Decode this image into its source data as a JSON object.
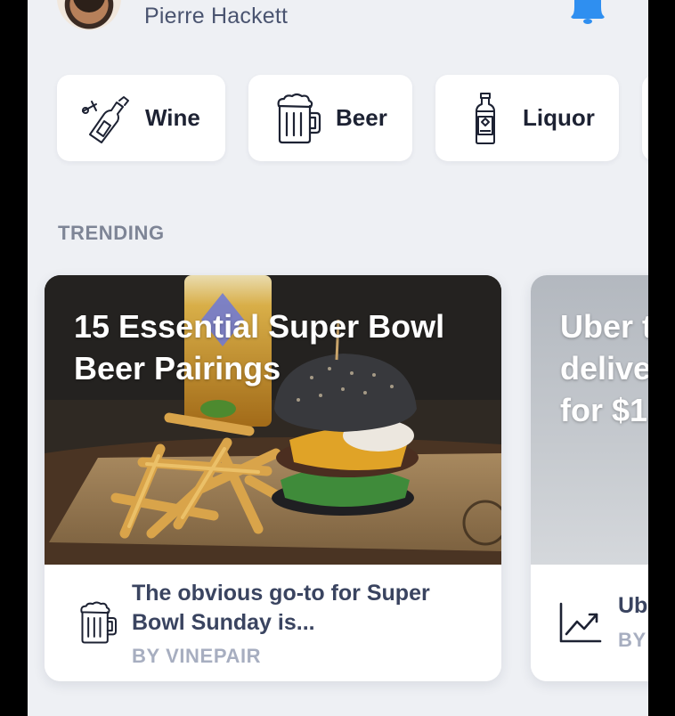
{
  "header": {
    "user_name": "Pierre Hackett"
  },
  "categories": [
    {
      "label": "Wine",
      "icon": "wine-bottle-icon"
    },
    {
      "label": "Beer",
      "icon": "beer-mug-icon"
    },
    {
      "label": "Liquor",
      "icon": "liquor-bottle-icon"
    }
  ],
  "trending": {
    "title": "TRENDING",
    "cards": [
      {
        "title": "15 Essential Super Bowl Beer Pairings",
        "excerpt": "The obvious go-to for Super Bowl Sunday is...",
        "byline": "BY VINEPAIR",
        "icon": "beer-mug-icon"
      },
      {
        "title": "Uber t\ndelive\nfor $1",
        "excerpt": "Ub",
        "byline": "BY",
        "icon": "trending-chart-icon"
      }
    ]
  },
  "colors": {
    "background": "#eef0f4",
    "accent": "#2f8ff0",
    "text_dark": "#1d2233",
    "text_muted": "#7e8596"
  }
}
